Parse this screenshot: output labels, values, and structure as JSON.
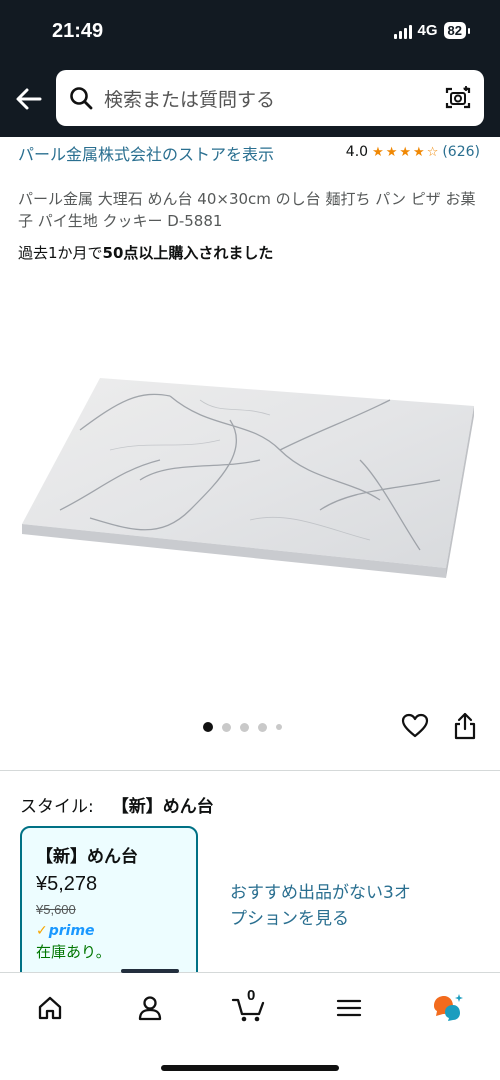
{
  "status": {
    "time": "21:49",
    "network": "4G",
    "battery": "82"
  },
  "search": {
    "placeholder": "検索または質問する"
  },
  "product": {
    "store_link": "パール金属株式会社のストアを表示",
    "rating": "4.0",
    "rating_count": "(626)",
    "stars": [
      1,
      1,
      1,
      1,
      0.5
    ],
    "title": "パール金属 大理石 めん台 40×30cm のし台 麺打ち パン ピザ お菓子 パイ生地 クッキー D-5881",
    "bought_prefix": "過去1か月で",
    "bought_bold": "50点以上購入されました"
  },
  "carousel": {
    "count": 5,
    "active_index": 0
  },
  "style": {
    "label": "スタイル:",
    "value": "【新】めん台",
    "option": {
      "name": "【新】めん台",
      "price": "¥5,278",
      "list_price": "¥5,600",
      "prime": "prime",
      "stock": "在庫あり。"
    },
    "more_options": "おすすめ出品がない3オプションを見る"
  },
  "nav": {
    "cart_count": "0",
    "items": [
      "home-icon",
      "account-icon",
      "cart-icon",
      "menu-icon",
      "rufus-icon"
    ]
  },
  "colors": {
    "header": "#121a22",
    "link": "#2a6f90",
    "star": "#f08804",
    "stock": "#007600",
    "prime": "#1a98ff"
  }
}
